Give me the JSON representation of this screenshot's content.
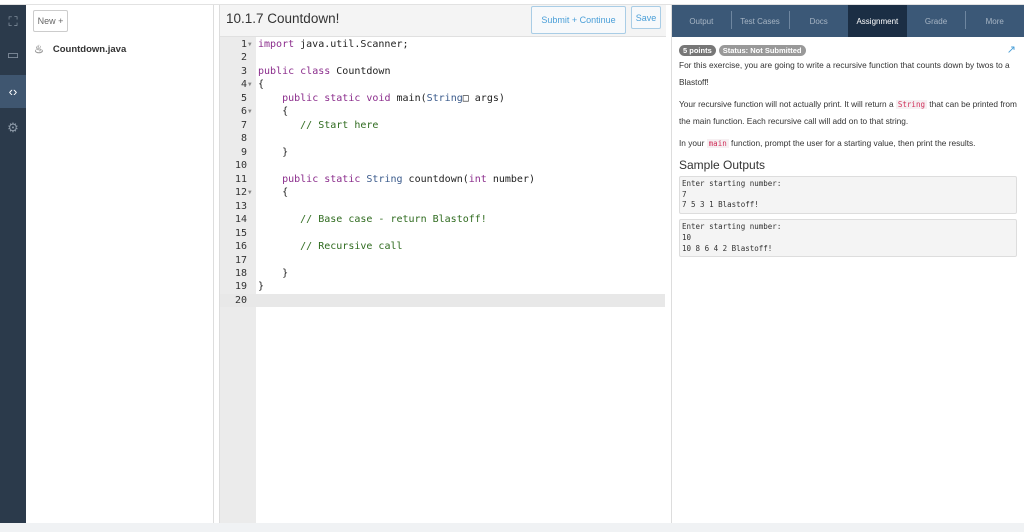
{
  "sidebar": {
    "icons": [
      "map-icon",
      "calendar-icon",
      "code-file-icon",
      "gear-icon"
    ]
  },
  "files": {
    "new_label": "New +",
    "items": [
      {
        "name": "Countdown.java"
      }
    ]
  },
  "editor": {
    "title": "10.1.7 Countdown!",
    "submit_label": "Submit + Continue",
    "save_label": "Save",
    "lines": [
      [
        [
          "import",
          "kw"
        ],
        [
          " java.util.Scanner;",
          ""
        ]
      ],
      [],
      [
        [
          "public",
          "kw"
        ],
        [
          " ",
          ""
        ],
        [
          "class",
          "kw"
        ],
        [
          " Countdown",
          ""
        ]
      ],
      [
        [
          "{",
          ""
        ]
      ],
      [
        [
          "    ",
          ""
        ],
        [
          "public",
          "kw"
        ],
        [
          " ",
          ""
        ],
        [
          "static",
          "kw"
        ],
        [
          " ",
          ""
        ],
        [
          "void",
          "kw"
        ],
        [
          " main(",
          ""
        ],
        [
          "String",
          "ty"
        ],
        [
          "□ args)",
          ""
        ]
      ],
      [
        [
          "    {",
          ""
        ]
      ],
      [
        [
          "       ",
          ""
        ],
        [
          "// Start here",
          "cm"
        ]
      ],
      [],
      [
        [
          "    }",
          ""
        ]
      ],
      [],
      [
        [
          "    ",
          ""
        ],
        [
          "public",
          "kw"
        ],
        [
          " ",
          ""
        ],
        [
          "static",
          "kw"
        ],
        [
          " ",
          ""
        ],
        [
          "String",
          "ty"
        ],
        [
          " countdown(",
          ""
        ],
        [
          "int",
          "kw"
        ],
        [
          " number)",
          ""
        ]
      ],
      [
        [
          "    {",
          ""
        ]
      ],
      [],
      [
        [
          "       ",
          ""
        ],
        [
          "// Base case - return Blastoff!",
          "cm"
        ]
      ],
      [],
      [
        [
          "       ",
          ""
        ],
        [
          "// Recursive call",
          "cm"
        ]
      ],
      [],
      [
        [
          "    }",
          ""
        ]
      ],
      [
        [
          "}",
          ""
        ]
      ],
      []
    ],
    "folds": [
      1,
      4,
      6,
      12
    ]
  },
  "panel": {
    "tabs": [
      "Output",
      "Test Cases",
      "Docs",
      "Assignment",
      "Grade",
      "More"
    ],
    "active_tab": "Assignment",
    "points": "5 points",
    "status": "Status: Not Submitted",
    "p1": "For this exercise, you are going to write a recursive function that counts down by twos to a Blastoff!",
    "p2a": "Your recursive function will not actually print. It will return a ",
    "p2code": "String",
    "p2b": " that can be printed from the main function. Each recursive call will add on to that string.",
    "p3a": "In your ",
    "p3code": "main",
    "p3b": " function, prompt the user for a starting value, then print the results.",
    "sample_heading": "Sample Outputs",
    "samples": [
      "Enter starting number:\n7\n7 5 3 1 Blastoff!",
      "Enter starting number:\n10\n10 8 6 4 2 Blastoff!"
    ]
  }
}
